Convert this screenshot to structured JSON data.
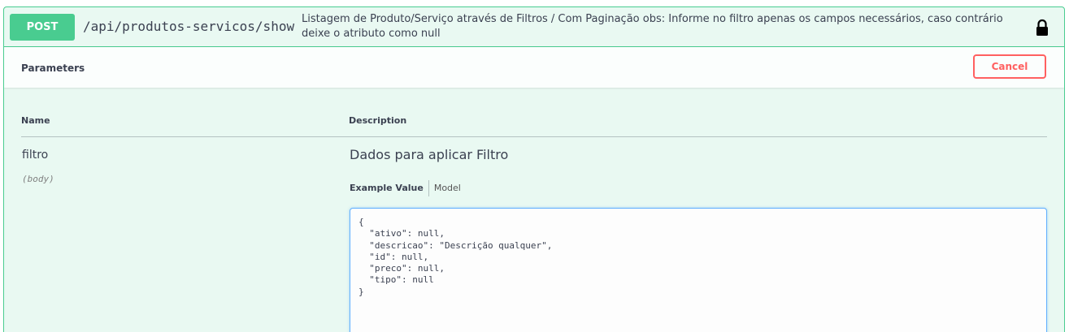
{
  "operation": {
    "method": "POST",
    "path": "/api/produtos-servicos/show",
    "description": "Listagem de Produto/Serviço através de Filtros / Com Paginação obs: Informe no filtro apenas os campos necessários, caso contrário deixe o atributo como null",
    "lock_icon": "lock-icon"
  },
  "parameters": {
    "title": "Parameters",
    "cancel_label": "Cancel",
    "col_name": "Name",
    "col_description": "Description",
    "param": {
      "name": "filtro",
      "in": "(body)",
      "description": "Dados para aplicar Filtro"
    },
    "tabs": {
      "example": "Example Value",
      "model": "Model"
    },
    "body_value": "{\n  \"ativo\": null,\n  \"descricao\": \"Descrição qualquer\",\n  \"id\": null,\n  \"preco\": null,\n  \"tipo\": null\n}"
  },
  "colors": {
    "post_green": "#49cc90",
    "cancel_red": "#ff6060",
    "focus_blue": "#61affe"
  }
}
